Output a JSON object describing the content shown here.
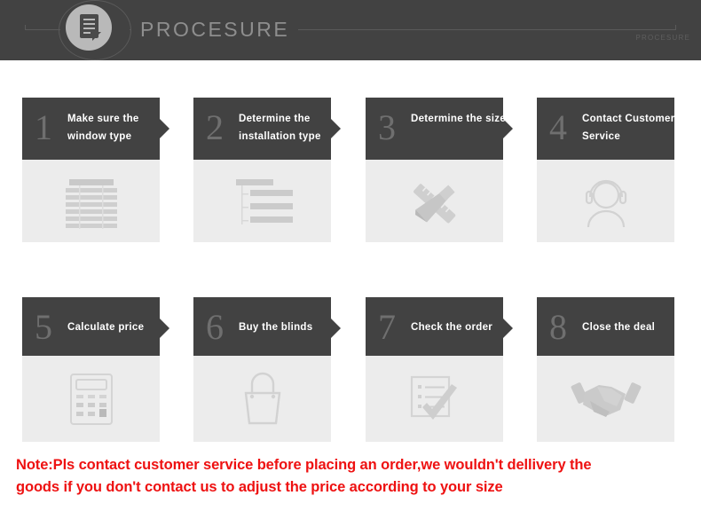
{
  "banner": {
    "title": "PROCESURE",
    "subtitle": "PROCESURE",
    "logo_icon": "document-icon",
    "bg_color": "#424242",
    "title_color": "#8e8e8e"
  },
  "theme": {
    "head_bg": "#424242",
    "body_bg": "#ececec",
    "number_color": "#6f6f6f",
    "title_color": "#ffffff",
    "note_color": "#ee1111"
  },
  "steps": [
    {
      "number": "1",
      "title": "Make sure the window type",
      "icon": "window-blinds-icon",
      "arrow": true
    },
    {
      "number": "2",
      "title": "Determine the installation type",
      "icon": "installation-tree-icon",
      "arrow": true
    },
    {
      "number": "3",
      "title": "Determine the size",
      "icon": "ruler-pencil-icon",
      "arrow": true
    },
    {
      "number": "4",
      "title": "Contact Customer Service",
      "icon": "customer-service-headset-icon",
      "arrow": false
    },
    {
      "number": "5",
      "title": "Calculate price",
      "icon": "calculator-icon",
      "arrow": true
    },
    {
      "number": "6",
      "title": "Buy the blinds",
      "icon": "shopping-bag-icon",
      "arrow": true
    },
    {
      "number": "7",
      "title": "Check the order",
      "icon": "checklist-check-icon",
      "arrow": true
    },
    {
      "number": "8",
      "title": "Close the deal",
      "icon": "handshake-icon",
      "arrow": false
    }
  ],
  "note": {
    "line1": "Note:Pls contact customer service before placing an order,we wouldn't dellivery the",
    "line2": "goods if you don't contact us to adjust the price according to your size"
  }
}
